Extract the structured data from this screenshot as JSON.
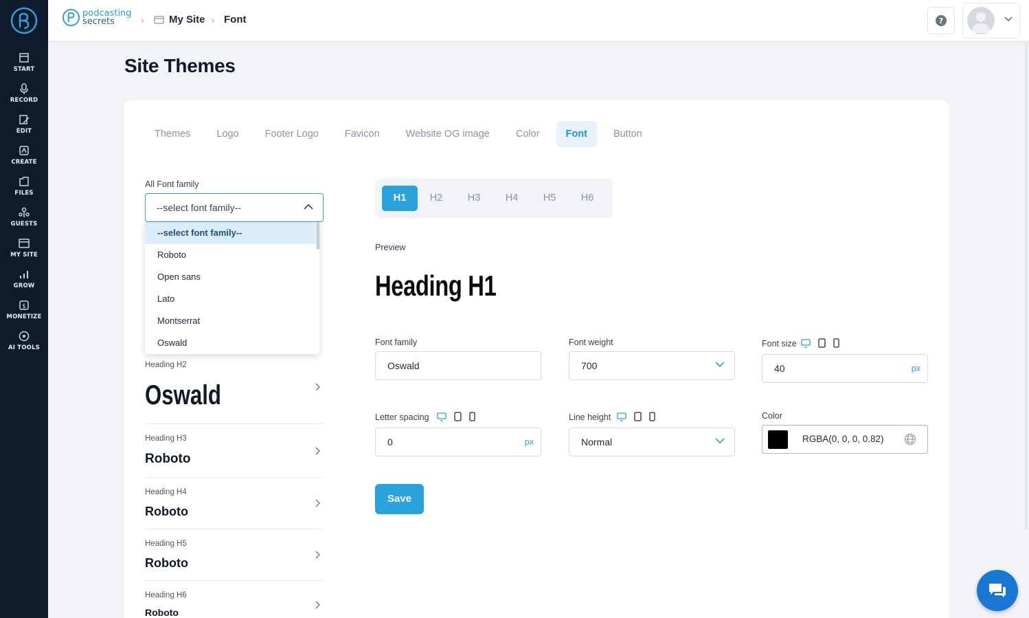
{
  "sidebar": {
    "items": [
      {
        "label": "START",
        "icon": "start-icon"
      },
      {
        "label": "RECORD",
        "icon": "microphone-icon"
      },
      {
        "label": "EDIT",
        "icon": "edit-icon"
      },
      {
        "label": "CREATE",
        "icon": "create-icon"
      },
      {
        "label": "FILES",
        "icon": "files-icon"
      },
      {
        "label": "GUESTS",
        "icon": "guests-icon"
      },
      {
        "label": "MY SITE",
        "icon": "my-site-icon"
      },
      {
        "label": "GROW",
        "icon": "grow-icon"
      },
      {
        "label": "MONETIZE",
        "icon": "monetize-icon"
      },
      {
        "label": "AI TOOLS",
        "icon": "ai-tools-icon"
      }
    ]
  },
  "header": {
    "brand_line1": "podcasting",
    "brand_line2": "secrets",
    "breadcrumb": [
      "My Site",
      "Font"
    ]
  },
  "page": {
    "title": "Site Themes",
    "tabs": [
      "Themes",
      "Logo",
      "Footer Logo",
      "Favicon",
      "Website OG image",
      "Color",
      "Font",
      "Button"
    ],
    "active_tab": "Font"
  },
  "font_family_panel": {
    "label": "All Font family",
    "selected": "--select font family--",
    "options": [
      "--select font family--",
      "Roboto",
      "Open sans",
      "Lato",
      "Montserrat",
      "Oswald"
    ],
    "headings": [
      {
        "label": "Heading H2",
        "value": "Oswald"
      },
      {
        "label": "Heading H3",
        "value": "Roboto"
      },
      {
        "label": "Heading H4",
        "value": "Roboto"
      },
      {
        "label": "Heading H5",
        "value": "Roboto"
      },
      {
        "label": "Heading H6",
        "value": "Roboto"
      }
    ]
  },
  "heading_tabs": [
    "H1",
    "H2",
    "H3",
    "H4",
    "H5",
    "H6"
  ],
  "active_heading": "H1",
  "preview": {
    "label": "Preview",
    "text": "Heading H1"
  },
  "settings": {
    "font_family_label": "Font family",
    "font_family_value": "Oswald",
    "font_weight_label": "Font weight",
    "font_weight_value": "700",
    "font_size_label": "Font size",
    "font_size_value": "40",
    "letter_spacing_label": "Letter spacing",
    "letter_spacing_value": "0",
    "line_height_label": "Line height",
    "line_height_value": "Normal",
    "color_label": "Color",
    "color_value": "RGBA(0, 0, 0, 0.82)",
    "unit": "px"
  },
  "save_label": "Save",
  "colors": {
    "accent": "#2aa3dc",
    "sidebar_bg": "#0e1b2c",
    "chat": "#1976d2"
  }
}
